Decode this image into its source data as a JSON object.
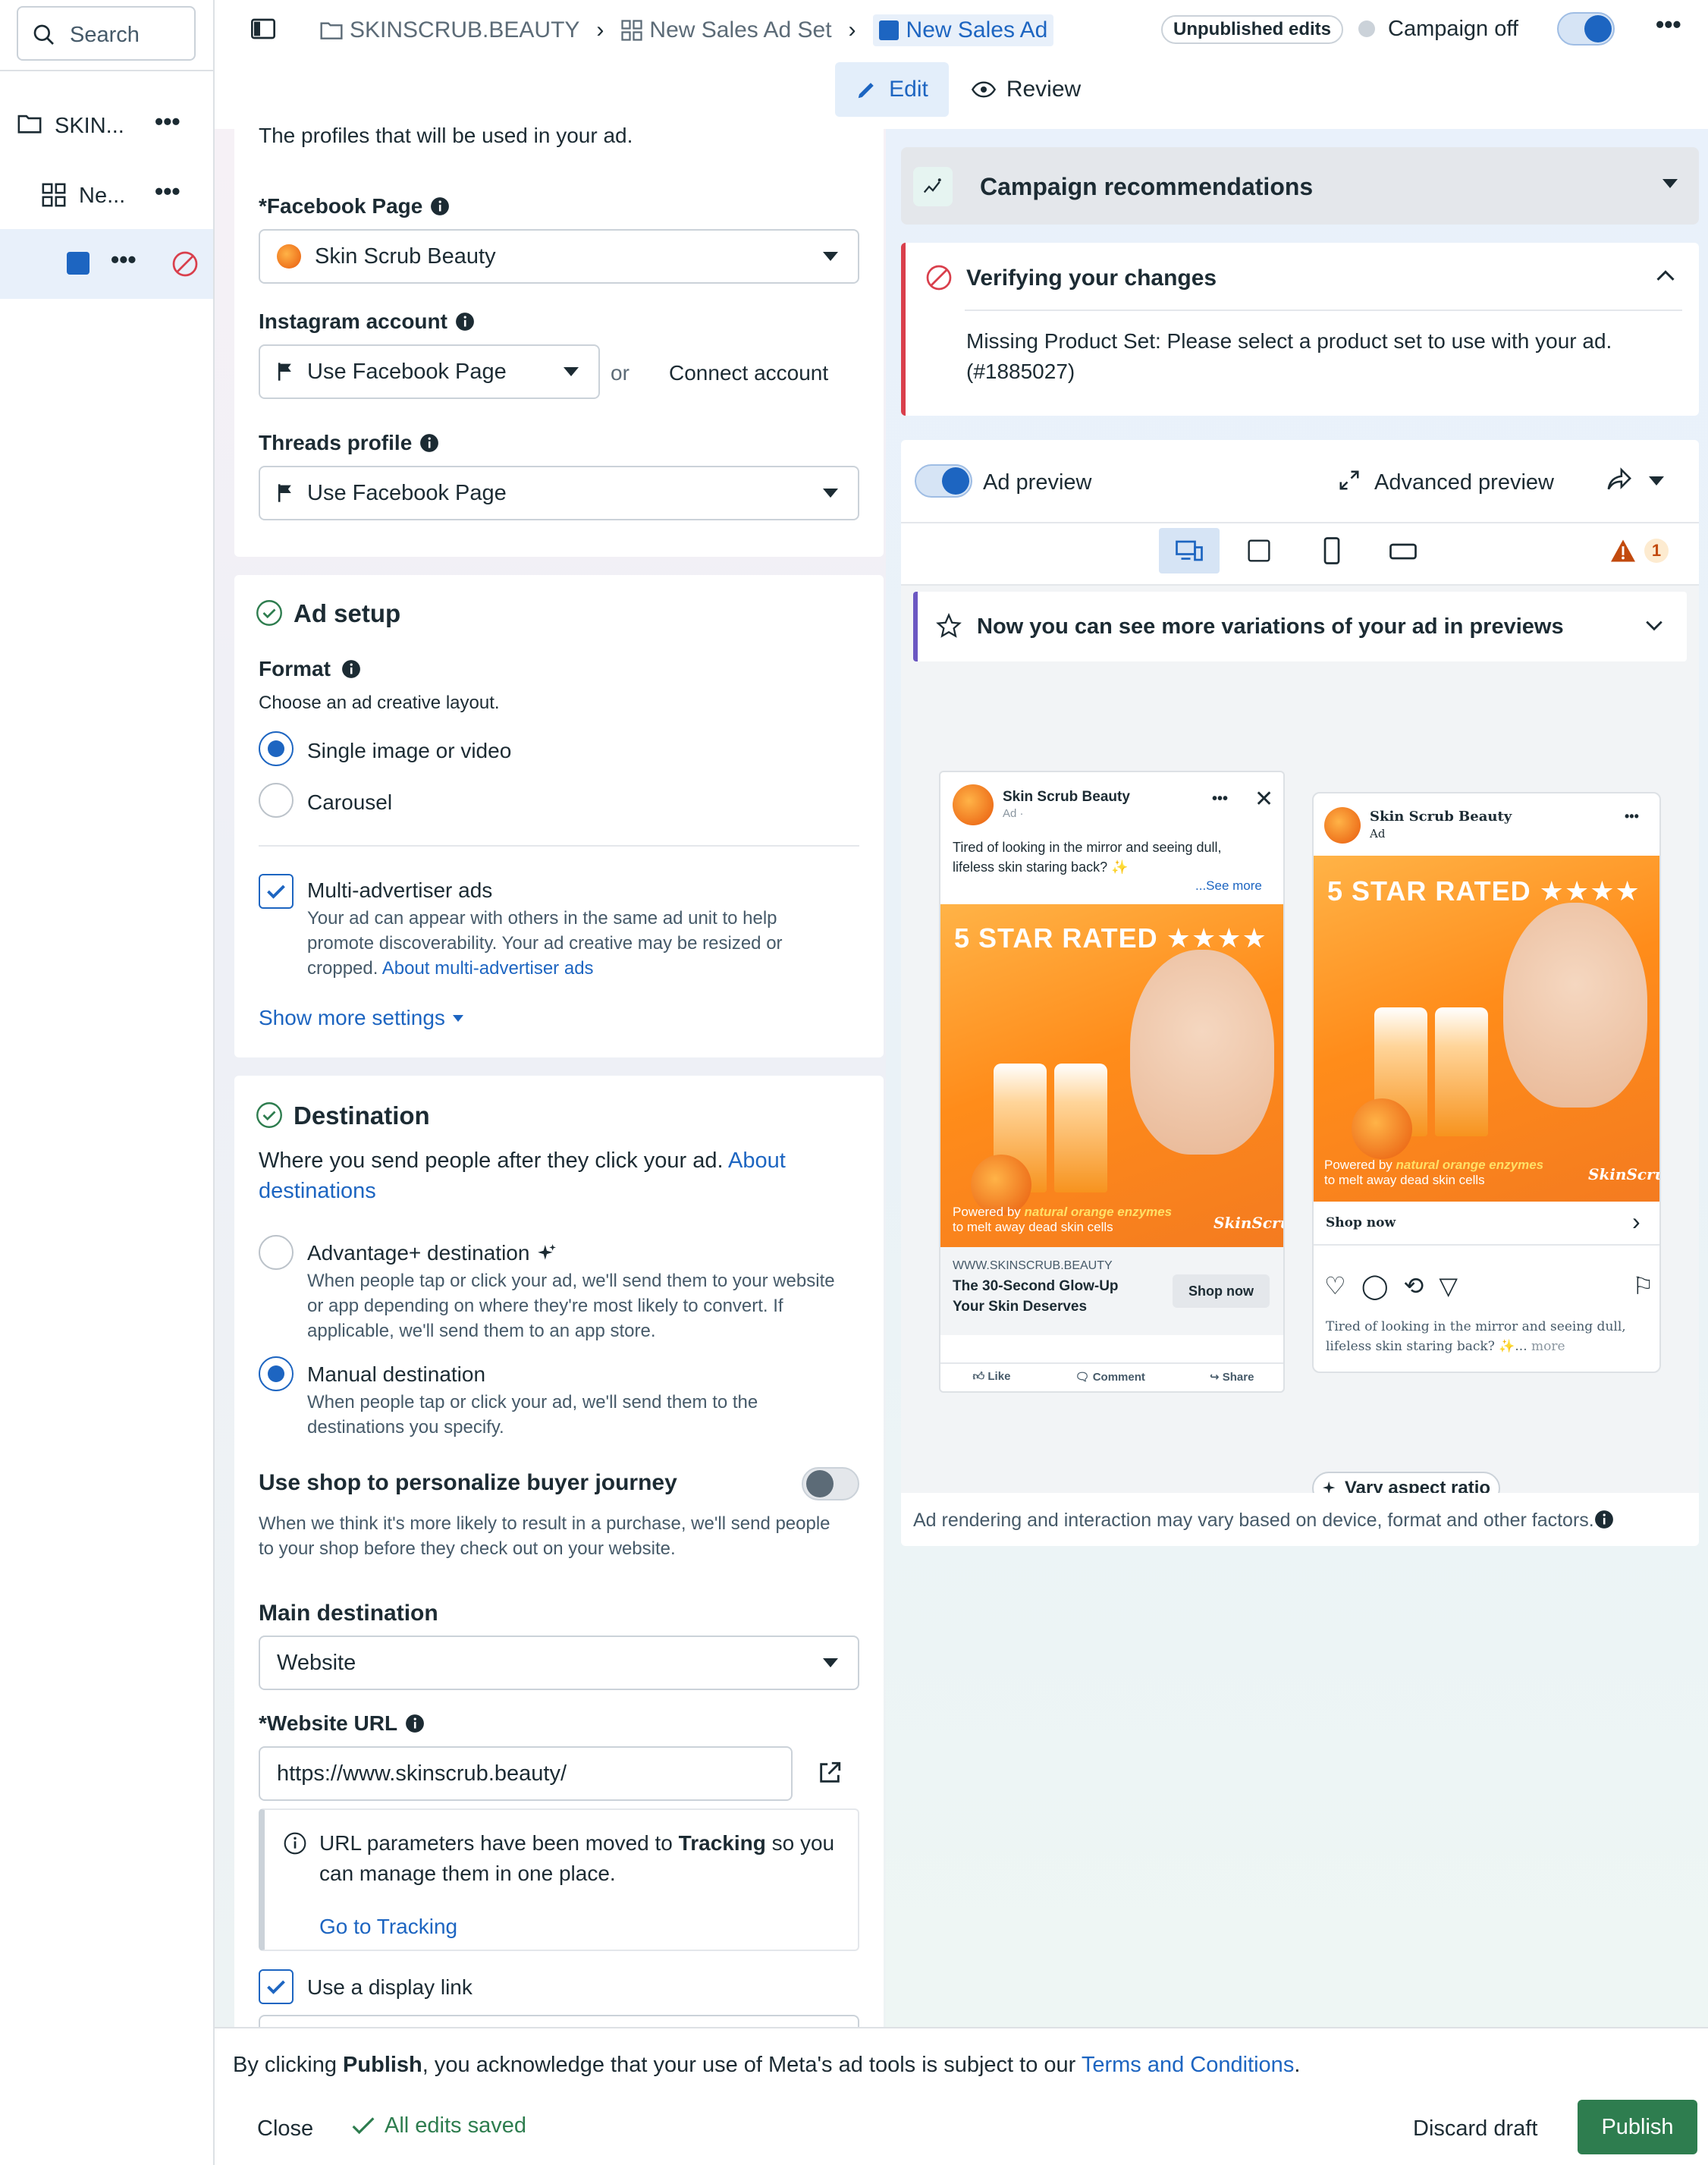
{
  "colors": {
    "accent": "#1d65c1",
    "publish": "#2e7d4f",
    "error": "#d93f4c",
    "warning": "#c24a0e"
  },
  "sidebar": {
    "search_placeholder": "Search",
    "items": [
      {
        "label": "SKIN...",
        "icon": "folder-icon"
      },
      {
        "label": "Ne...",
        "icon": "grid-icon"
      },
      {
        "label": "",
        "icon": "ad-icon"
      }
    ]
  },
  "header": {
    "breadcrumb": [
      "SKINSCRUB.BEAUTY",
      "New Sales Ad Set",
      "New Sales Ad"
    ],
    "unpublished": "Unpublished edits",
    "campaign_status": "Campaign off",
    "tabs": {
      "edit": "Edit",
      "review": "Review"
    }
  },
  "identity": {
    "intro": "The profiles that will be used in your ad.",
    "facebook_label": "Facebook Page",
    "facebook_value": "Skin Scrub Beauty",
    "instagram_label": "Instagram account",
    "instagram_value": "Use Facebook Page",
    "or": "or",
    "connect": "Connect account",
    "threads_label": "Threads profile",
    "threads_value": "Use Facebook Page"
  },
  "ad_setup": {
    "title": "Ad setup",
    "format_label": "Format",
    "format_sub": "Choose an ad creative layout.",
    "opt_single": "Single image or video",
    "opt_carousel": "Carousel",
    "multi_label": "Multi-advertiser ads",
    "multi_desc_1": "Your ad can appear with others in the same ad unit to help",
    "multi_desc_2": "promote discoverability. Your ad creative may be resized or",
    "multi_desc_3": "cropped.",
    "multi_link": "About multi-advertiser ads",
    "show_more": "Show more settings"
  },
  "destination": {
    "title": "Destination",
    "sub": "Where you send people after they click your ad.",
    "about_1": "About",
    "about_2": "destinations",
    "adv_label": "Advantage+ destination",
    "adv_desc_1": "When people tap or click your ad, we'll send them to your website",
    "adv_desc_2": "or app depending on where they're most likely to convert. If",
    "adv_desc_3": "applicable, we'll send them to an app store.",
    "manual_label": "Manual destination",
    "manual_desc_1": "When people tap or click your ad, we'll send them to the",
    "manual_desc_2": "destinations you specify.",
    "shop_label": "Use shop to personalize buyer journey",
    "shop_desc_1": "When we think it's more likely to result in a purchase, we'll send people",
    "shop_desc_2": "to your shop before they check out on your website.",
    "main_label": "Main destination",
    "main_value": "Website",
    "url_label": "Website URL",
    "url_value": "https://www.skinscrub.beauty/",
    "notice_1a": "URL parameters have been moved to ",
    "notice_1b": "Tracking",
    "notice_1c": " so you",
    "notice_2": "can manage them in one place.",
    "notice_link": "Go to Tracking",
    "display_link": "Use a display link"
  },
  "right": {
    "reco": "Campaign recommendations",
    "verify_title": "Verifying your changes",
    "verify_msg_1": "Missing Product Set: Please select a product set to use with your ad.",
    "verify_msg_2": "(#1885027)",
    "preview_label": "Ad preview",
    "advanced": "Advanced preview",
    "warn_count": "1",
    "variations": "Now you can see more variations of your ad in previews",
    "vary": "Vary aspect ratio",
    "disclaimer": "Ad rendering and interaction may vary based on device, format and other factors."
  },
  "fb_mock": {
    "page": "Skin Scrub Beauty",
    "ad": "Ad · ",
    "text_1": "Tired of looking in the mirror and seeing dull,",
    "text_2": "lifeless skin staring back? ✨",
    "see_more": "...See more",
    "banner": "5 STAR RATED ★★★★",
    "powered_1a": "Powered by ",
    "powered_1b": "natural orange enzymes",
    "powered_2": "to melt away dead skin cells",
    "logo": "SkinScrub",
    "domain": "WWW.SKINSCRUB.BEAUTY",
    "headline_1": "The 30-Second Glow-Up",
    "headline_2": "Your Skin Deserves",
    "cta": "Shop now",
    "like": "Like",
    "comment": "Comment",
    "share": "Share"
  },
  "ig_mock": {
    "page": "Skin Scrub Beauty",
    "ad": "Ad",
    "banner": "5 STAR RATED ★★★★",
    "powered_1a": "Powered by ",
    "powered_1b": "natural orange enzymes",
    "powered_2": "to melt away dead skin cells",
    "logo": "SkinScrub",
    "cta": "Shop now",
    "caption_1": "Tired of looking in the mirror and seeing dull,",
    "caption_2": "lifeless skin staring back? ✨...",
    "more": "more"
  },
  "footer": {
    "consent_a": "By clicking ",
    "consent_b": "Publish",
    "consent_c": ", you acknowledge that your use of Meta's ad tools is subject to our ",
    "terms": "Terms and Conditions",
    "dot": ".",
    "close": "Close",
    "saved": "All edits saved",
    "discard": "Discard draft",
    "publish": "Publish"
  }
}
